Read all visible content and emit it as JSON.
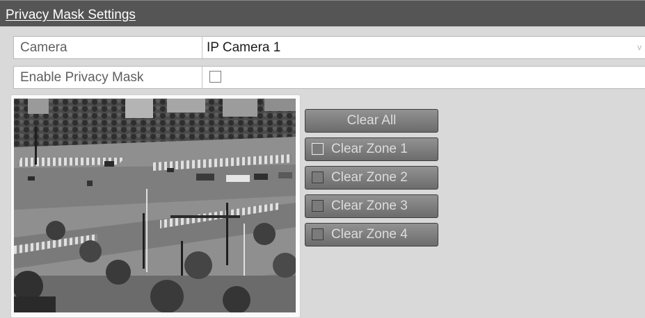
{
  "header": {
    "title": "Privacy Mask Settings"
  },
  "camera_row": {
    "label": "Camera",
    "value": "IP Camera 1",
    "arrow": "v"
  },
  "mask_row": {
    "label": "Enable Privacy Mask",
    "checked": false
  },
  "preview": {
    "description_icon": "camera-preview-image"
  },
  "buttons": {
    "clear_all": "Clear All",
    "zones": [
      {
        "label": "Clear Zone 1"
      },
      {
        "label": "Clear Zone 2"
      },
      {
        "label": "Clear Zone 3"
      },
      {
        "label": "Clear Zone 4"
      }
    ]
  }
}
